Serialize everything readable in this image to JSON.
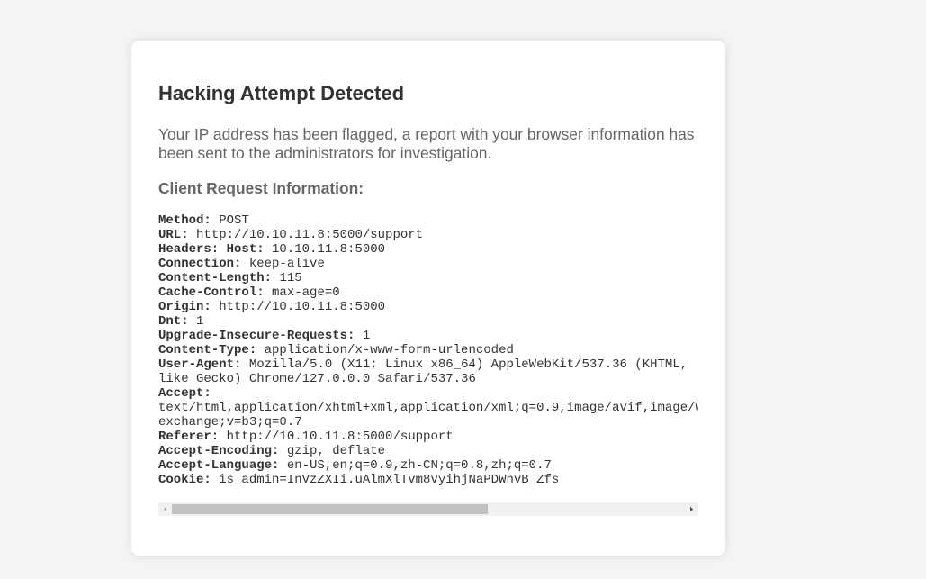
{
  "page": {
    "title": "Hacking Attempt Detected",
    "message": "Your IP address has been flagged, a report with your browser information has been sent to the administrators for investigation.",
    "subheading": "Client Request Information:"
  },
  "request": {
    "method_key": "Method:",
    "method_val": "POST",
    "url_key": "URL:",
    "url_val": "http://10.10.11.8:5000/support",
    "host_key": "Headers: Host:",
    "host_val": "10.10.11.8:5000",
    "connection_key": "Connection:",
    "connection_val": "keep-alive",
    "content_length_key": "Content-Length:",
    "content_length_val": "115",
    "cache_control_key": "Cache-Control:",
    "cache_control_val": "max-age=0",
    "origin_key": "Origin:",
    "origin_val": "http://10.10.11.8:5000",
    "dnt_key": "Dnt:",
    "dnt_val": "1",
    "upgrade_key": "Upgrade-Insecure-Requests:",
    "upgrade_val": "1",
    "content_type_key": "Content-Type:",
    "content_type_val": "application/x-www-form-urlencoded",
    "user_agent_key": "User-Agent:",
    "user_agent_val": "Mozilla/5.0 (X11; Linux x86_64) AppleWebKit/537.36 (KHTML, like Gecko) Chrome/127.0.0.0 Safari/537.36",
    "accept_key": "Accept:",
    "accept_val_line1": "text/html,application/xhtml+xml,application/xml;q=0.9,image/avif,image/w",
    "accept_val_line2": "exchange;v=b3;q=0.7",
    "referer_key": "Referer:",
    "referer_val": "http://10.10.11.8:5000/support",
    "accept_encoding_key": "Accept-Encoding:",
    "accept_encoding_val": "gzip, deflate",
    "accept_language_key": "Accept-Language:",
    "accept_language_val": "en-US,en;q=0.9,zh-CN;q=0.8,zh;q=0.7",
    "cookie_key": "Cookie:",
    "cookie_val": "is_admin=InVzZXIi.uAlmXlTvm8vyihjNaPDWnvB_Zfs"
  },
  "scrollbar": {
    "thumb_fraction": 0.615,
    "position_fraction": 0.0
  },
  "colors": {
    "background": "#f4f4f4",
    "card": "#ffffff",
    "title": "#333333",
    "muted_text": "#666666",
    "scroll_thumb": "#c1c1c1",
    "scroll_track": "#f1f1f1"
  },
  "icons": {
    "scroll_left": "triangle-left-icon",
    "scroll_right": "triangle-right-icon"
  }
}
